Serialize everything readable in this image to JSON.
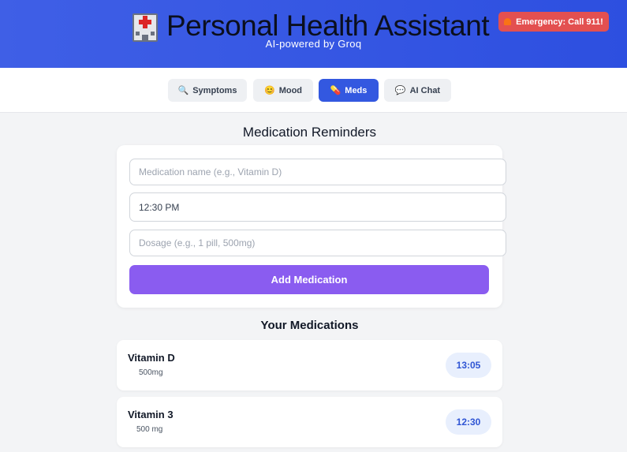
{
  "header": {
    "title": "Personal Health Assistant",
    "subtitle": "AI-powered by Groq",
    "emergency_label": "Emergency: Call 911!"
  },
  "nav": {
    "tabs": [
      {
        "icon": "🔍",
        "label": "Symptoms",
        "active": false
      },
      {
        "icon": "😊",
        "label": "Mood",
        "active": false
      },
      {
        "icon": "💊",
        "label": "Meds",
        "active": true
      },
      {
        "icon": "💬",
        "label": "AI Chat",
        "active": false
      }
    ]
  },
  "form": {
    "title": "Medication Reminders",
    "name_placeholder": "Medication name (e.g., Vitamin D)",
    "time_value": "12:30 PM",
    "dosage_placeholder": "Dosage (e.g., 1 pill, 500mg)",
    "add_label": "Add Medication"
  },
  "list": {
    "title": "Your Medications",
    "items": [
      {
        "name": "Vitamin D",
        "dosage": "500mg",
        "time": "13:05"
      },
      {
        "name": "Vitamin 3",
        "dosage": "500 mg",
        "time": "12:30"
      }
    ]
  },
  "colors": {
    "header_bg": "#3f5fe6",
    "active_tab": "#3358e0",
    "add_button": "#8a5cf0",
    "emergency": "#e35050",
    "time_badge_text": "#2f55d4"
  }
}
